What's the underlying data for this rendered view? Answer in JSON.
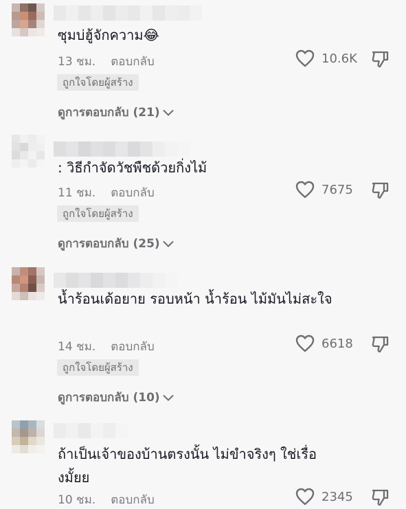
{
  "labels": {
    "reply": "ตอบกลับ",
    "creator_liked": "ถูกใจโดยผู้สร้าง"
  },
  "icons": {
    "like": "heart-outline-icon",
    "dislike": "thumbs-down-icon",
    "expand": "chevron-down-icon",
    "emoji": "face-with-tears-of-joy"
  },
  "comments": [
    {
      "text": "ซุมบ่ฮู้จักความ😂",
      "time": "13 ชม.",
      "likes": "10.6K",
      "creator_liked": true,
      "view_replies": "ดูการตอบกลับ (21)"
    },
    {
      "text": ": วิธีกำจัดวัชพืชด้วยกิ่งไม้",
      "time": "11 ชม.",
      "likes": "7675",
      "creator_liked": true,
      "view_replies": "ดูการตอบกลับ (25)"
    },
    {
      "text": "น้ำร้อนเด้อยาย รอบหน้า น้ำร้อน ไม้มันไม่สะใจ",
      "time": "14 ชม.",
      "likes": "6618",
      "creator_liked": true,
      "view_replies": "ดูการตอบกลับ (10)"
    },
    {
      "text": "ถ้าเป็นเจ้าของบ้านตรงนั้น ไม่ขำจริงๆ ใช่เรื่องมั้ยย",
      "time": "10 ชม.",
      "likes": "2345",
      "creator_liked": false,
      "view_replies": ""
    }
  ]
}
